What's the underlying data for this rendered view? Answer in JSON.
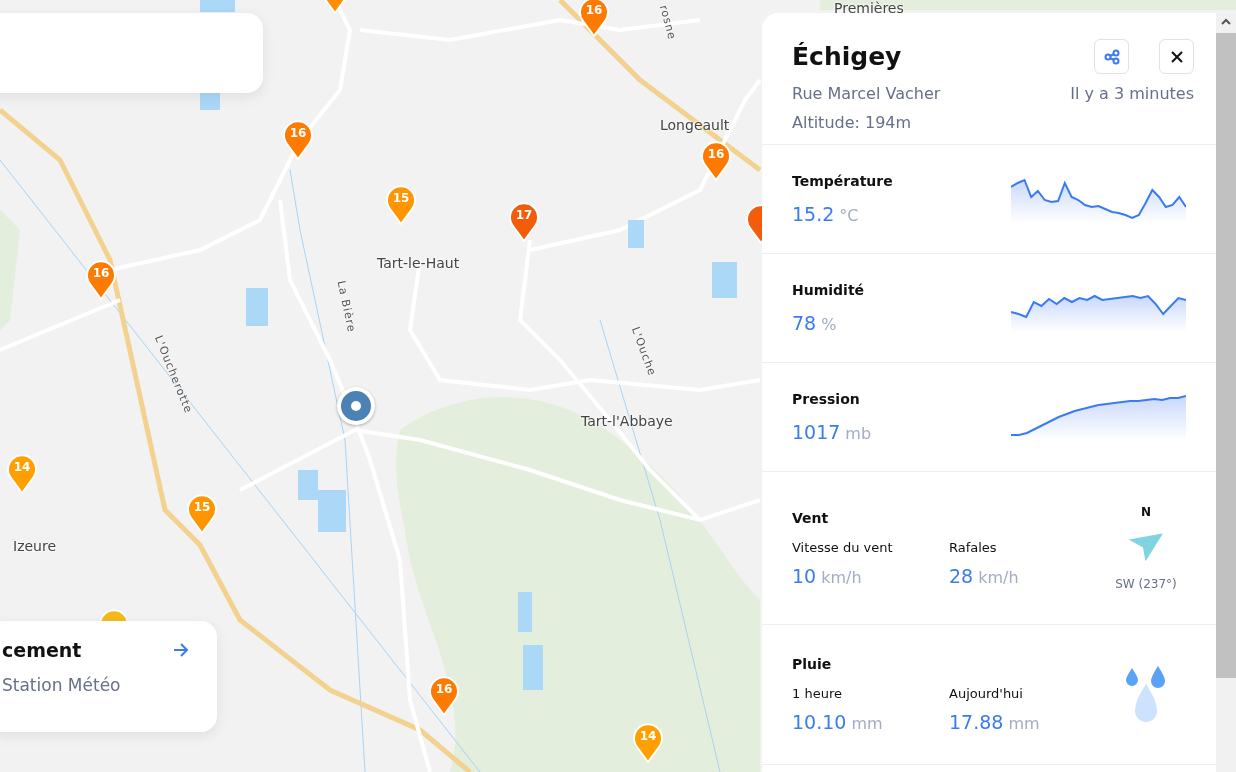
{
  "map": {
    "places": [
      {
        "name": "Premières",
        "kind": "town"
      },
      {
        "name": "rosne",
        "kind": "river"
      },
      {
        "name": "Longeault",
        "kind": "town"
      },
      {
        "name": "Tart-le-Haut",
        "kind": "town"
      },
      {
        "name": "La Bière",
        "kind": "river"
      },
      {
        "name": "L'Oucherotte",
        "kind": "river"
      },
      {
        "name": "L'Ouche",
        "kind": "river"
      },
      {
        "name": "Tart-l'Abbaye",
        "kind": "town"
      },
      {
        "name": "Izeure",
        "kind": "town"
      }
    ],
    "pins": [
      {
        "color": "#ff8f00"
      },
      {
        "label": "16",
        "color": "#ff7a00"
      },
      {
        "label": "16",
        "color": "#ff7a00"
      },
      {
        "label": "15",
        "color": "#ff9500"
      },
      {
        "label": "17",
        "color": "#f25c0a"
      },
      {
        "label": "16",
        "color": "#ff7a00"
      },
      {
        "color": "#f25c0a"
      },
      {
        "label": "16",
        "color": "#ff7a00"
      },
      {
        "label": "14",
        "color": "#ffa000"
      },
      {
        "label": "15",
        "color": "#ff9500"
      },
      {
        "color": "#f6b91c"
      },
      {
        "label": "16",
        "color": "#ff7a00"
      },
      {
        "label": "14",
        "color": "#ffa000"
      }
    ]
  },
  "link_card": {
    "title": "cement",
    "subtitle": "Station Météo"
  },
  "station": {
    "name": "Échigey",
    "street": "Rue Marcel Vacher",
    "updated": "Il y a 3 minutes",
    "altitude": "Altitude: 194m"
  },
  "sections": [
    {
      "kind": "chart",
      "title": "Température",
      "value": "15.2",
      "unit": "°C"
    },
    {
      "kind": "chart",
      "title": "Humidité",
      "value": "78",
      "unit": "%"
    },
    {
      "kind": "chart",
      "title": "Pression",
      "value": "1017",
      "unit": "mb"
    },
    {
      "kind": "wind",
      "title": "Vent",
      "metrics": [
        {
          "label": "Vitesse du vent",
          "value": "10",
          "unit": "km/h"
        },
        {
          "label": "Rafales",
          "value": "28",
          "unit": "km/h"
        }
      ],
      "north": "N",
      "direction": "SW (237°)"
    },
    {
      "kind": "rain",
      "title": "Pluie",
      "metrics": [
        {
          "label": "1 heure",
          "value": "10.10",
          "unit": "mm"
        },
        {
          "label": "Aujourd'hui",
          "value": "17.88",
          "unit": "mm"
        }
      ]
    }
  ]
}
